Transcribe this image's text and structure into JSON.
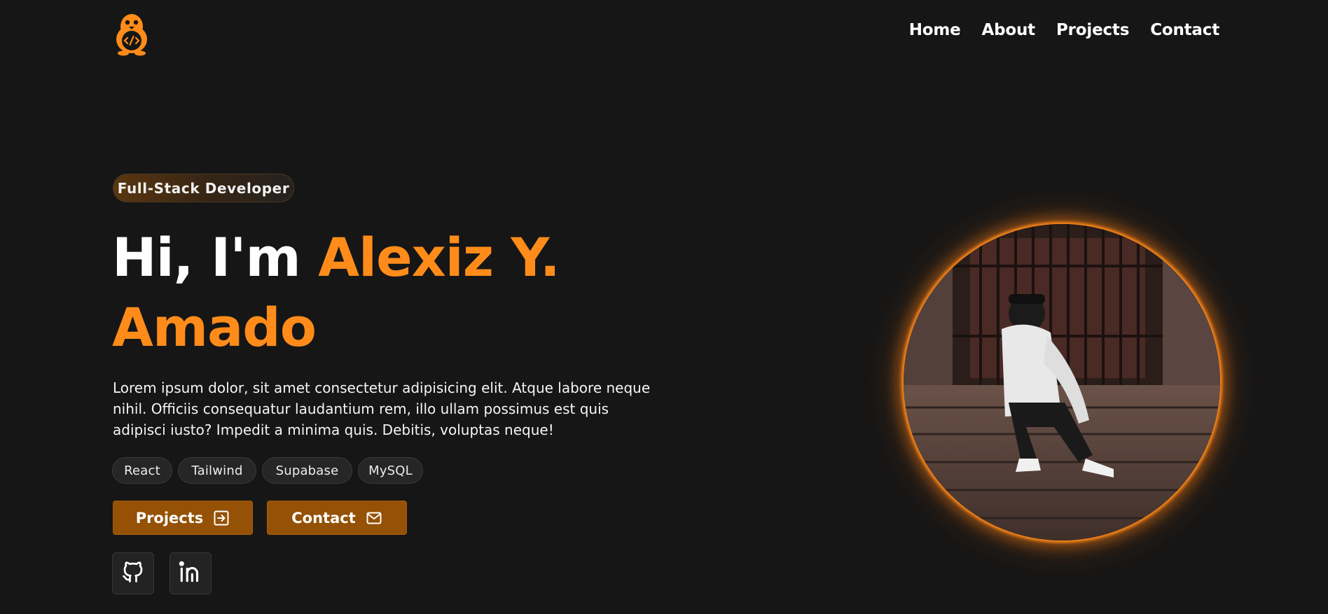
{
  "nav": {
    "items": [
      {
        "label": "Home"
      },
      {
        "label": "About"
      },
      {
        "label": "Projects"
      },
      {
        "label": "Contact"
      }
    ]
  },
  "hero": {
    "badge": "Full-Stack Developer",
    "greeting": "Hi, I'm",
    "name_first": "Alexiz Y.",
    "name_last": "Amado",
    "description": "Lorem ipsum dolor, sit amet consectetur adipisicing elit. Atque labore neque nihil. Officiis consequatur laudantium rem, illo ullam possimus est quis adipisci iusto? Impedit a minima quis. Debitis, voluptas neque!",
    "tags": [
      "React",
      "Tailwind",
      "Supabase",
      "MySQL"
    ],
    "buttons": {
      "projects": {
        "label": "Projects",
        "icon": "arrow-right-square-icon"
      },
      "contact": {
        "label": "Contact",
        "icon": "mail-icon"
      }
    },
    "social": [
      {
        "icon": "github-icon"
      },
      {
        "icon": "linkedin-icon"
      }
    ]
  },
  "theme": {
    "background": "#161616",
    "accent": "#ff8c1a",
    "button": "#955105"
  }
}
